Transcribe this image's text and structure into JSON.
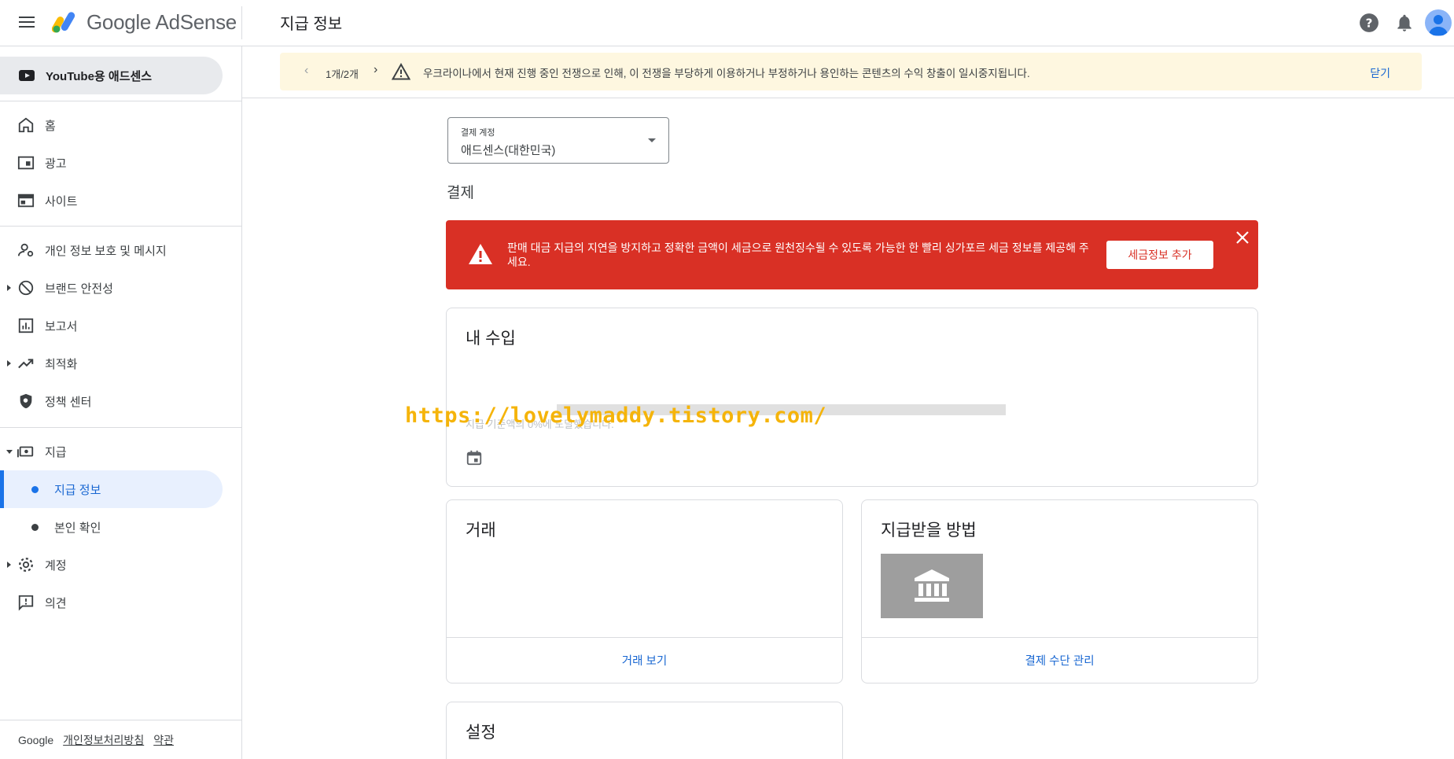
{
  "app": {
    "brand": "Google AdSense",
    "page_title": "지급 정보"
  },
  "sidebar": {
    "youtube_item": "YouTube용 애드센스",
    "items": [
      {
        "label": "홈"
      },
      {
        "label": "광고"
      },
      {
        "label": "사이트"
      },
      {
        "label": "개인 정보 보호 및 메시지"
      },
      {
        "label": "브랜드 안전성"
      },
      {
        "label": "보고서"
      },
      {
        "label": "최적화"
      },
      {
        "label": "정책 센터"
      },
      {
        "label": "지급"
      },
      {
        "label": "지급 정보"
      },
      {
        "label": "본인 확인"
      },
      {
        "label": "계정"
      },
      {
        "label": "의견"
      }
    ],
    "footer": {
      "brand": "Google",
      "privacy": "개인정보처리방침",
      "terms": "약관"
    }
  },
  "banner": {
    "prev": "‹",
    "count": "1개/2개",
    "next": "›",
    "message": "우크라이나에서 현재 진행 중인 전쟁으로 인해, 이 전쟁을 부당하게 이용하거나 부정하거나 용인하는 콘텐츠의 수익 창출이 일시중지됩니다.",
    "close": "닫기"
  },
  "account_select": {
    "label": "결제 계정",
    "value": "애드센스(대한민국)"
  },
  "section_title": "결제",
  "alert": {
    "message": "판매 대금 지급의 지연을 방지하고 정확한 금액이 세금으로 원천징수될 수 있도록 가능한 한 빨리 싱가포르 세금 정보를 제공해 주세요.",
    "button": "세금정보 추가"
  },
  "earnings": {
    "title": "내 수입",
    "subtitle": "지급 기준액의 0%에 도달했습니다."
  },
  "watermark": "https://lovelymaddy.tistory.com/",
  "transactions": {
    "title": "거래",
    "link": "거래 보기"
  },
  "payment_method": {
    "title": "지급받을 방법",
    "link": "결제 수단 관리"
  },
  "settings": {
    "title": "설정"
  },
  "colors": {
    "alert_red": "#d93025",
    "accent_blue": "#1a73e8",
    "banner_bg": "#fef7e0"
  }
}
